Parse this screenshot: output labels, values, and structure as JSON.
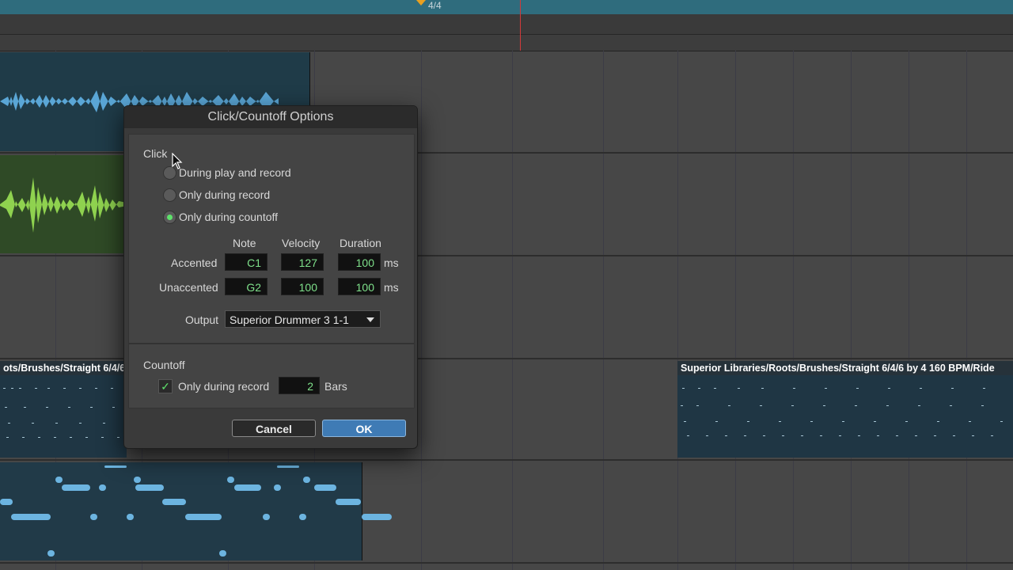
{
  "timeline": {
    "meter": "4/4"
  },
  "regions": {
    "drum_left_title": "ots/Brushes/Straight 6/4/6",
    "drum_right_title": "Superior Libraries/Roots/Brushes/Straight 6/4/6 by 4 160 BPM/Ride"
  },
  "dialog": {
    "title": "Click/Countoff Options",
    "click": {
      "section_label": "Click",
      "options": [
        {
          "label": "During play and record",
          "selected": false
        },
        {
          "label": "Only during record",
          "selected": false
        },
        {
          "label": "Only during countoff",
          "selected": true
        }
      ],
      "columns": {
        "note": "Note",
        "velocity": "Velocity",
        "duration": "Duration"
      },
      "accented": {
        "label": "Accented",
        "note": "C1",
        "velocity": "127",
        "duration": "100",
        "unit": "ms"
      },
      "unaccented": {
        "label": "Unaccented",
        "note": "G2",
        "velocity": "100",
        "duration": "100",
        "unit": "ms"
      },
      "output": {
        "label": "Output",
        "value": "Superior Drummer 3 1-1"
      }
    },
    "countoff": {
      "section_label": "Countoff",
      "checkbox_label": "Only during record",
      "checked": true,
      "bars": "2",
      "bars_unit": "Bars"
    },
    "buttons": {
      "cancel": "Cancel",
      "ok": "OK"
    }
  },
  "colors": {
    "accent_green": "#5ee26b",
    "ok_blue": "#3f7bb5",
    "playhead": "#d23a3a"
  }
}
